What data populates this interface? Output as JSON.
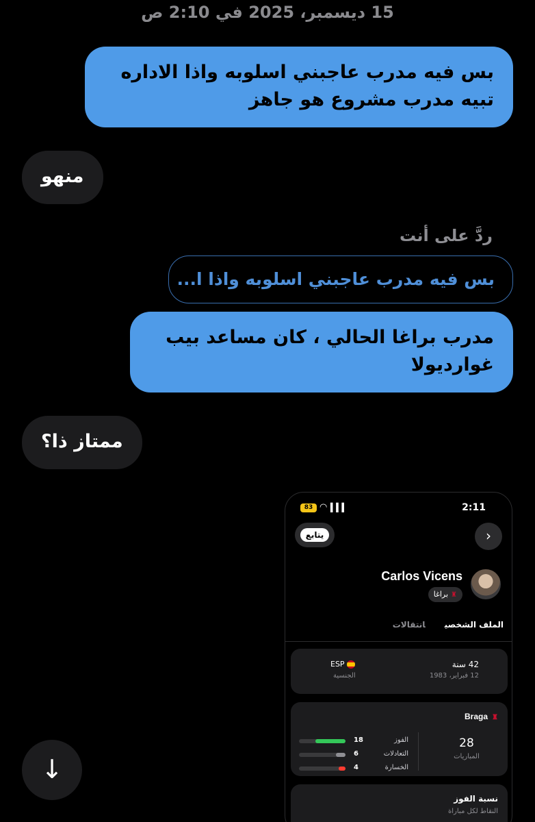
{
  "timestamp": "15 ديسمبر، 2025 في 2:10 ص",
  "messages": [
    {
      "text": "بس فيه مدرب عاجبني اسلوبه واذا الاداره تبيه مدرب مشروع هو جاهز"
    },
    {
      "text": "منهو"
    },
    {
      "reply_label": "ردَّ على أنت",
      "quoted": "بس فيه مدرب عاجبني اسلوبه واذا ا...",
      "text": "مدرب براغا الحالي ، كان مساعد بيب غوارديولا"
    },
    {
      "text": "ممتاز ذا؟"
    }
  ],
  "shot": {
    "time": "2:11",
    "battery": "83",
    "follow": "يتابع",
    "nav_icon": "›",
    "player_name": "Carlos Vicens",
    "club": "براغا",
    "tabs": [
      "الملف الشخصي",
      "انتقالات"
    ],
    "age": "42 سنة",
    "dob": "12 فبراير، 1983",
    "nationality": "ESP",
    "nationality_label": "الجنسية",
    "team": "Braga",
    "matches": "28",
    "matches_label": "المباريات",
    "stats": [
      {
        "label": "الفوز",
        "value": "18",
        "color": "#34c759",
        "fraction": 0.64
      },
      {
        "label": "التعادلات",
        "value": "6",
        "color": "#8e8e93",
        "fraction": 0.21
      },
      {
        "label": "الخسارة",
        "value": "4",
        "color": "#ff3b30",
        "fraction": 0.14
      }
    ],
    "winrate_title": "نسبة الفوز",
    "winrate_sub": "النقاط لكل مباراة"
  },
  "scroll_icon": "↓"
}
